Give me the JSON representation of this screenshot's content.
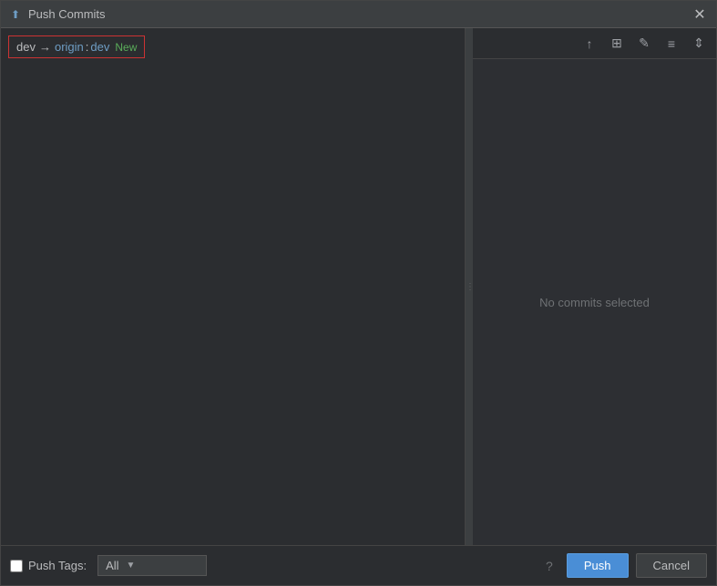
{
  "window": {
    "title": "Push Commits",
    "icon": "⬆"
  },
  "branch": {
    "local": "dev",
    "arrow": "→",
    "remote": "origin",
    "colon": ":",
    "target": "dev",
    "badge": "New"
  },
  "toolbar": {
    "icons": [
      {
        "name": "push-icon",
        "symbol": "↑"
      },
      {
        "name": "grid-icon",
        "symbol": "⊞"
      },
      {
        "name": "edit-icon",
        "symbol": "✎"
      },
      {
        "name": "align-icon",
        "symbol": "☰"
      },
      {
        "name": "expand-icon",
        "symbol": "⇕"
      }
    ]
  },
  "commits_panel": {
    "empty_text": "No commits selected"
  },
  "footer": {
    "push_tags_label": "Push Tags:",
    "dropdown_value": "All",
    "push_button": "Push",
    "cancel_button": "Cancel",
    "help_symbol": "?"
  }
}
